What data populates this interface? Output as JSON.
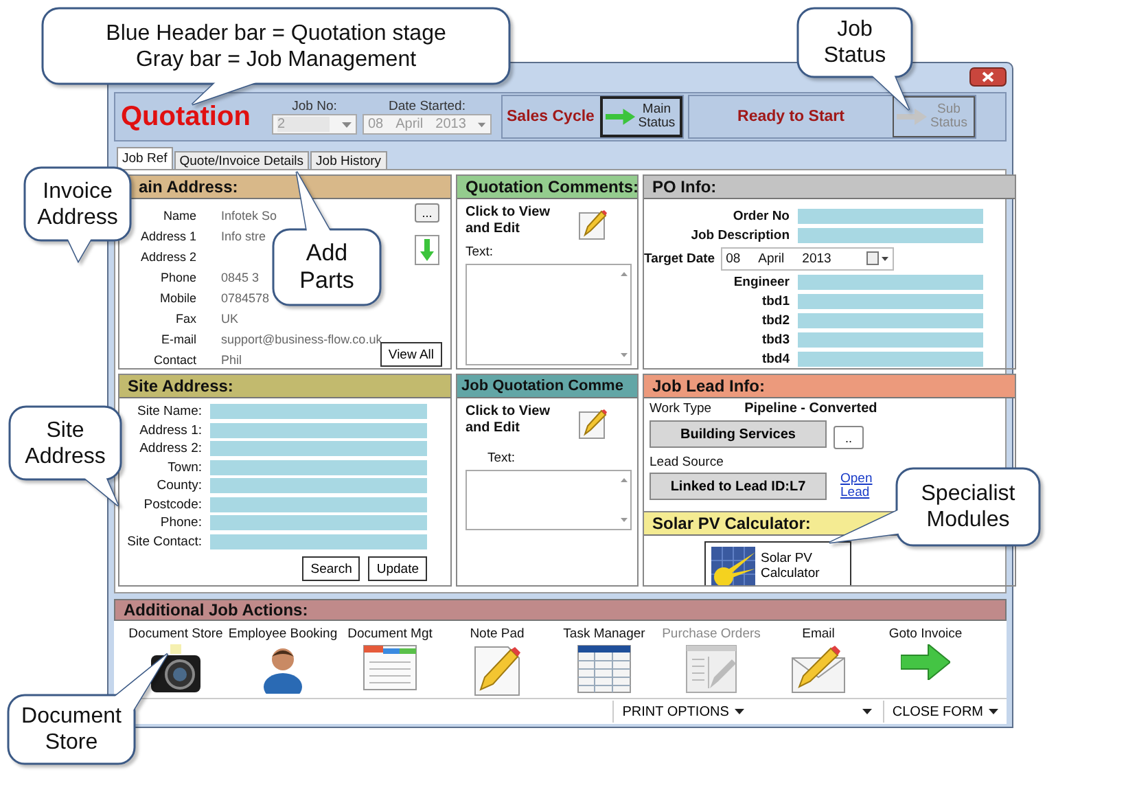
{
  "callouts": [
    {
      "lines": [
        "Blue Header bar = Quotation stage",
        "Gray bar = Job Management"
      ]
    },
    {
      "lines": [
        "Job",
        "Status"
      ]
    },
    {
      "lines": [
        "Invoice",
        "Address"
      ]
    },
    {
      "lines": [
        "Add",
        "Parts"
      ]
    },
    {
      "lines": [
        "Site",
        "Address"
      ]
    },
    {
      "lines": [
        "Specialist",
        "Modules"
      ]
    },
    {
      "lines": [
        "Document",
        "Store"
      ]
    }
  ],
  "header": {
    "stage": "Quotation",
    "job_no": {
      "label": "Job No:",
      "value": "2",
      "disabled": true
    },
    "date_started": {
      "label": "Date Started:",
      "day": "08",
      "month": "April",
      "year": "2013",
      "disabled": true
    },
    "cycle": "Sales Cycle",
    "main_status": {
      "label": "Main Status",
      "disabled": false
    },
    "status": "Ready to Start",
    "sub_status": {
      "label": "Sub Status",
      "disabled": true
    }
  },
  "tabs": [
    {
      "label": "Job Ref",
      "selected": true
    },
    {
      "label": "Quote/Invoice Details",
      "selected": false
    },
    {
      "label": "Job History",
      "selected": false
    }
  ],
  "main_address": {
    "title": "ain Address:",
    "fields": [
      {
        "label": "Name",
        "value": "Infotek So"
      },
      {
        "label": "Address 1",
        "value": "Info stre"
      },
      {
        "label": "Address 2"
      },
      {
        "label": "Phone",
        "value": "0845 3"
      },
      {
        "label": "Mobile",
        "value": "0784578"
      },
      {
        "label": "Fax",
        "value": "UK"
      },
      {
        "label": "E-mail",
        "value": "support@business-flow.co.uk"
      },
      {
        "label": "Contact",
        "value": "Phil"
      }
    ],
    "more_button": "...",
    "view_all": "View All"
  },
  "quotation_comments": {
    "title": "Quotation Comments:",
    "prompt": "Click to View and Edit",
    "text_label": "Text:"
  },
  "po_info": {
    "title": "PO Info:",
    "fields": [
      {
        "label": "Order No",
        "kind": "text"
      },
      {
        "label": "Job Description",
        "kind": "text"
      },
      {
        "label": "Target Date",
        "kind": "date",
        "day": "08",
        "month": "April",
        "year": "2013"
      },
      {
        "label": "Engineer",
        "kind": "text"
      },
      {
        "label": "tbd1",
        "kind": "text"
      },
      {
        "label": "tbd2",
        "kind": "text"
      },
      {
        "label": "tbd3",
        "kind": "text"
      },
      {
        "label": "tbd4",
        "kind": "text"
      }
    ]
  },
  "site_address": {
    "title": "Site Address:",
    "fields": [
      "Site Name:",
      "Address 1:",
      "Address 2:",
      "Town:",
      "County:",
      "Postcode:",
      "Phone:",
      "Site Contact:"
    ],
    "buttons": [
      "Search",
      "Update"
    ]
  },
  "job_quotation_comments": {
    "title": "Job Quotation Comme",
    "prompt": "Click to View and Edit",
    "text_label": "Text:"
  },
  "job_lead_info": {
    "title": "Job Lead Info:",
    "work_type_label": "Work Type",
    "work_type_value": "Pipeline - Converted",
    "work_type_button": "Building Services",
    "more_button": "..",
    "lead_source_label": "Lead Source",
    "lead_button": "Linked to Lead ID:L7",
    "open_link": "Open Lead"
  },
  "solar": {
    "title": "Solar PV Calculator:",
    "button": "Solar PV Calculator"
  },
  "actions": {
    "title": "Additional Job Actions:",
    "items": [
      {
        "label": "Document Store",
        "kind": "camera",
        "disabled": false
      },
      {
        "label": "Employee Booking",
        "kind": "person",
        "disabled": false
      },
      {
        "label": "Document Mgt",
        "kind": "document",
        "disabled": false
      },
      {
        "label": "Note Pad",
        "kind": "notepad",
        "disabled": false
      },
      {
        "label": "Task Manager",
        "kind": "table",
        "disabled": false
      },
      {
        "label": "Purchase Orders",
        "kind": "form",
        "disabled": true
      },
      {
        "label": "Email",
        "kind": "email",
        "disabled": false
      },
      {
        "label": "Goto Invoice",
        "kind": "arrow",
        "disabled": false
      }
    ]
  },
  "status_bar": {
    "print": "PRINT OPTIONS",
    "close": "CLOSE FORM"
  }
}
